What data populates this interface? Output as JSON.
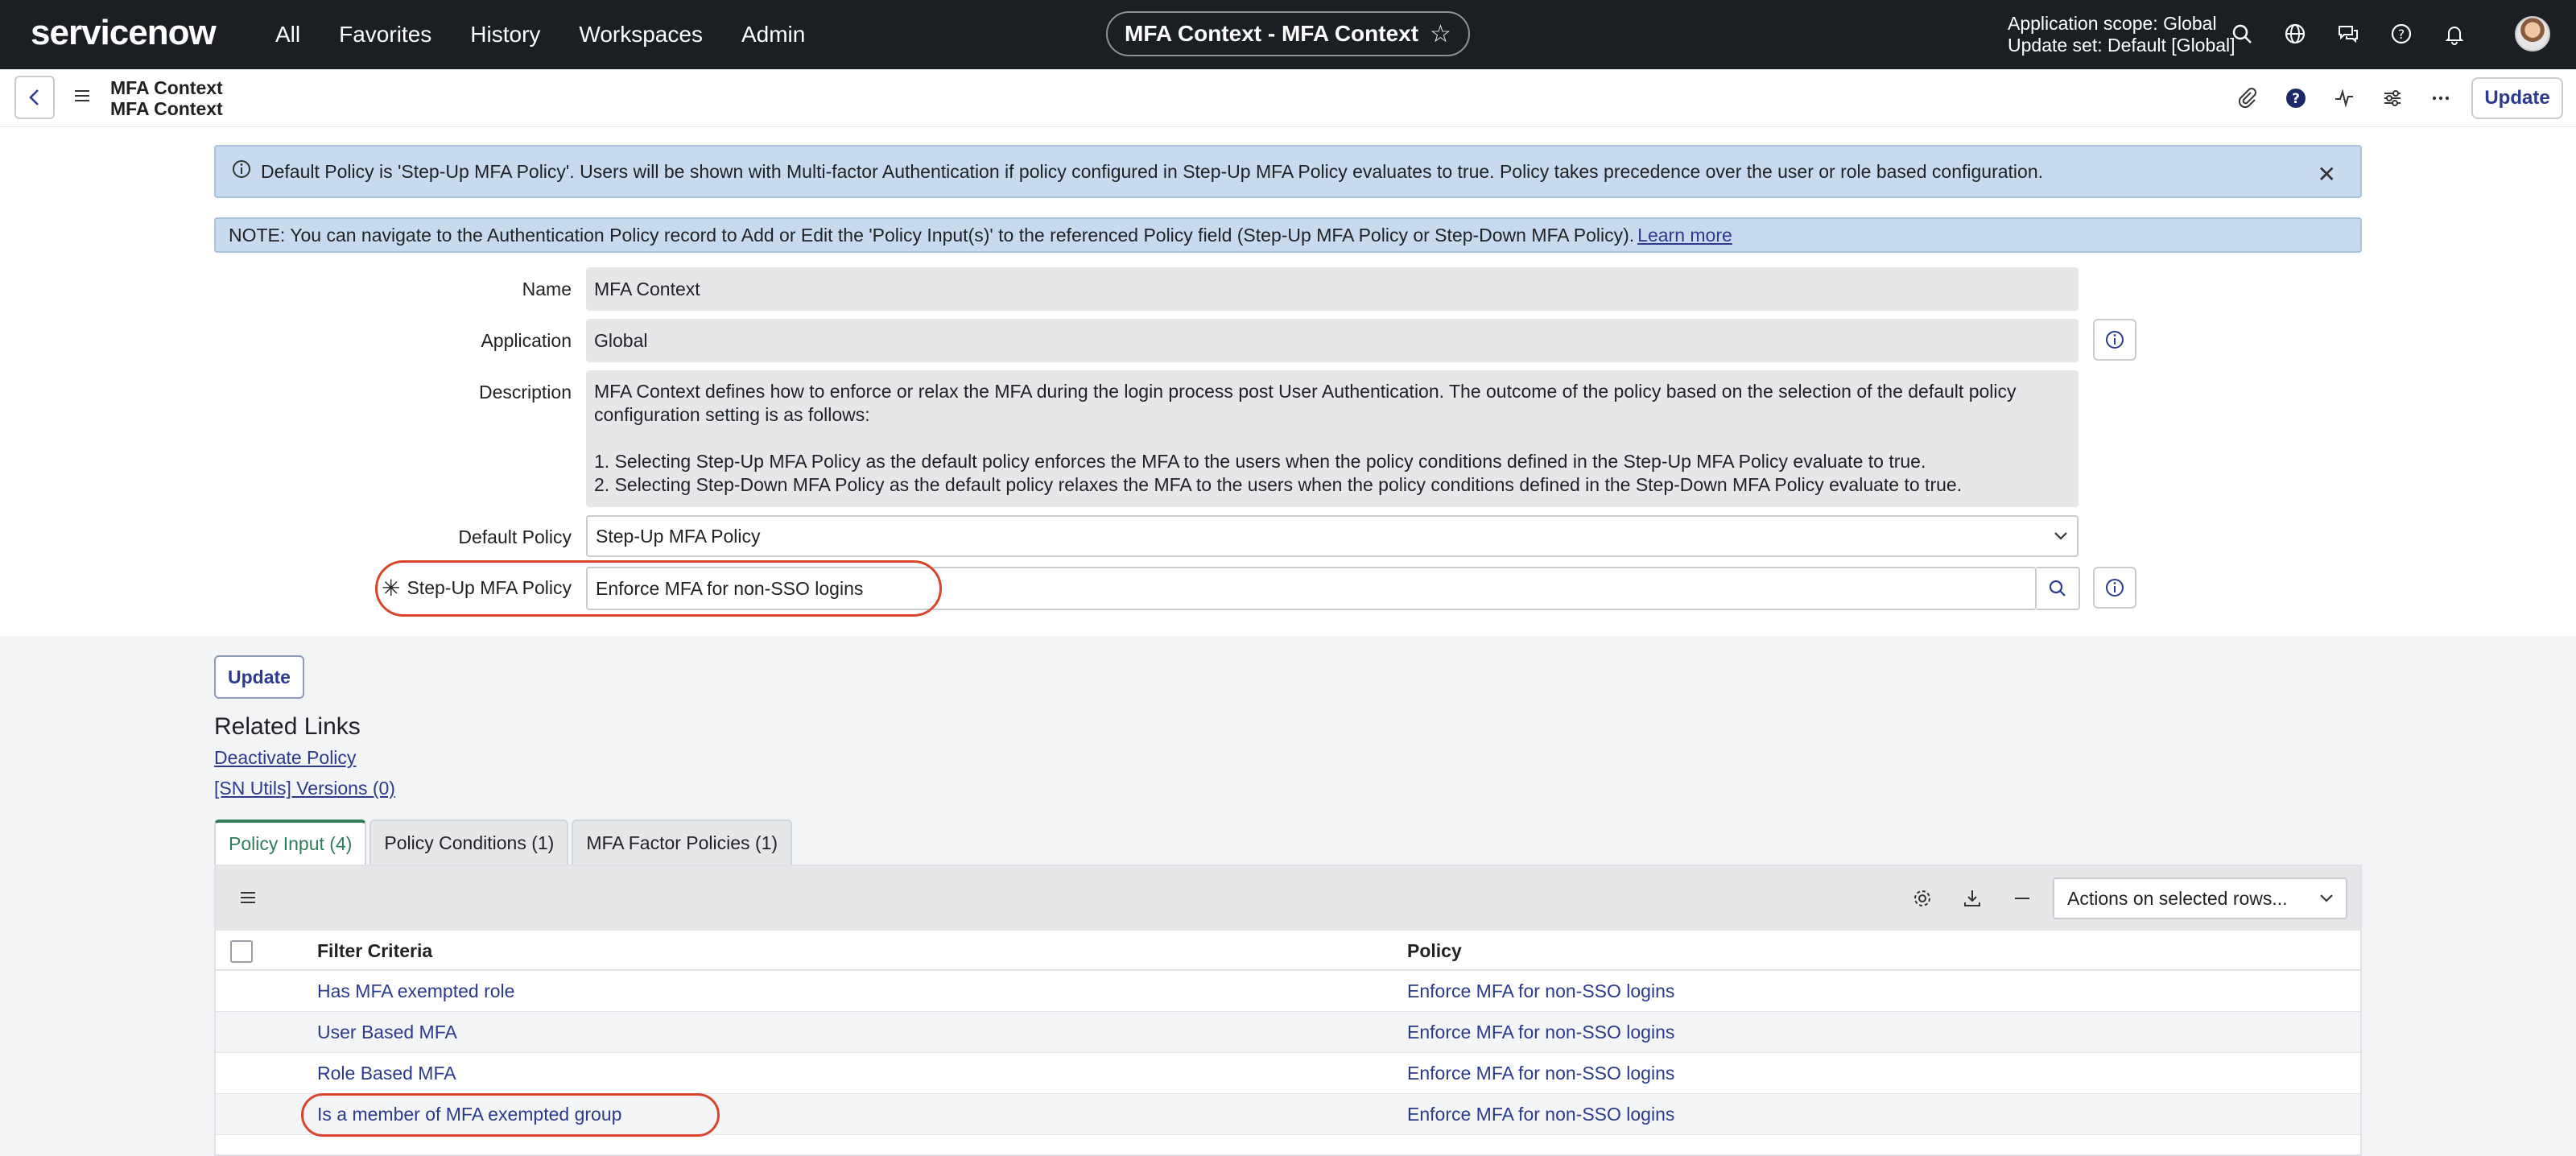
{
  "topnav": {
    "logo_text": "servicenow",
    "menu": [
      "All",
      "Favorites",
      "History",
      "Workspaces",
      "Admin"
    ],
    "context_title": "MFA Context - MFA Context",
    "scope_line1": "Application scope: Global",
    "scope_line2": "Update set: Default [Global]"
  },
  "subheader": {
    "title_line1": "MFA Context",
    "title_line2": "MFA Context",
    "update_label": "Update"
  },
  "banners": {
    "info": "Default Policy is 'Step-Up MFA Policy'. Users will be shown with Multi-factor Authentication if policy configured in Step-Up MFA Policy evaluates to true. Policy takes precedence over the user or role based configuration.",
    "note": "NOTE: You can navigate to the Authentication Policy record to Add or Edit the 'Policy Input(s)' to the referenced Policy field (Step-Up MFA Policy or Step-Down MFA Policy).",
    "note_link": "Learn more"
  },
  "form": {
    "name_label": "Name",
    "name_value": "MFA Context",
    "application_label": "Application",
    "application_value": "Global",
    "description_label": "Description",
    "description_line1": "MFA Context defines how to enforce or relax the MFA during the login process post User Authentication. The outcome of the policy based on the selection of the default policy",
    "description_line2": "configuration setting is as follows:",
    "description_line3": "1. Selecting Step-Up MFA Policy as the default policy enforces the MFA to the users when the policy conditions defined in the Step-Up MFA Policy evaluate to true.",
    "description_line4": "2. Selecting Step-Down MFA Policy as the default policy relaxes the MFA to the users when the policy conditions defined in the Step-Down MFA Policy evaluate to true.",
    "default_policy_label": "Default Policy",
    "default_policy_value": "Step-Up MFA Policy",
    "stepup_label": "Step-Up MFA Policy",
    "stepup_value": "Enforce MFA for non-SSO logins"
  },
  "lower": {
    "update_label": "Update",
    "related_links_title": "Related Links",
    "link1": "Deactivate Policy",
    "link2": "[SN Utils] Versions (0)",
    "tabs": [
      {
        "label": "Policy Input (4)"
      },
      {
        "label": "Policy Conditions (1)"
      },
      {
        "label": "MFA Factor Policies (1)"
      }
    ],
    "actions_select": "Actions on selected rows...",
    "columns": {
      "filter": "Filter Criteria",
      "policy": "Policy"
    },
    "rows": [
      {
        "filter": "Has MFA exempted role",
        "policy": "Enforce MFA for non-SSO logins"
      },
      {
        "filter": "User Based MFA",
        "policy": "Enforce MFA for non-SSO logins"
      },
      {
        "filter": "Role Based MFA",
        "policy": "Enforce MFA for non-SSO logins"
      },
      {
        "filter": "Is a member of MFA exempted group",
        "policy": "Enforce MFA for non-SSO logins"
      }
    ]
  },
  "colors": {
    "nav_bg": "#1b1f23",
    "banner_bg": "#c8dbee",
    "link": "#2b3a8c",
    "active_tab": "#2e7d5b",
    "highlight_oval": "#d9452b"
  }
}
